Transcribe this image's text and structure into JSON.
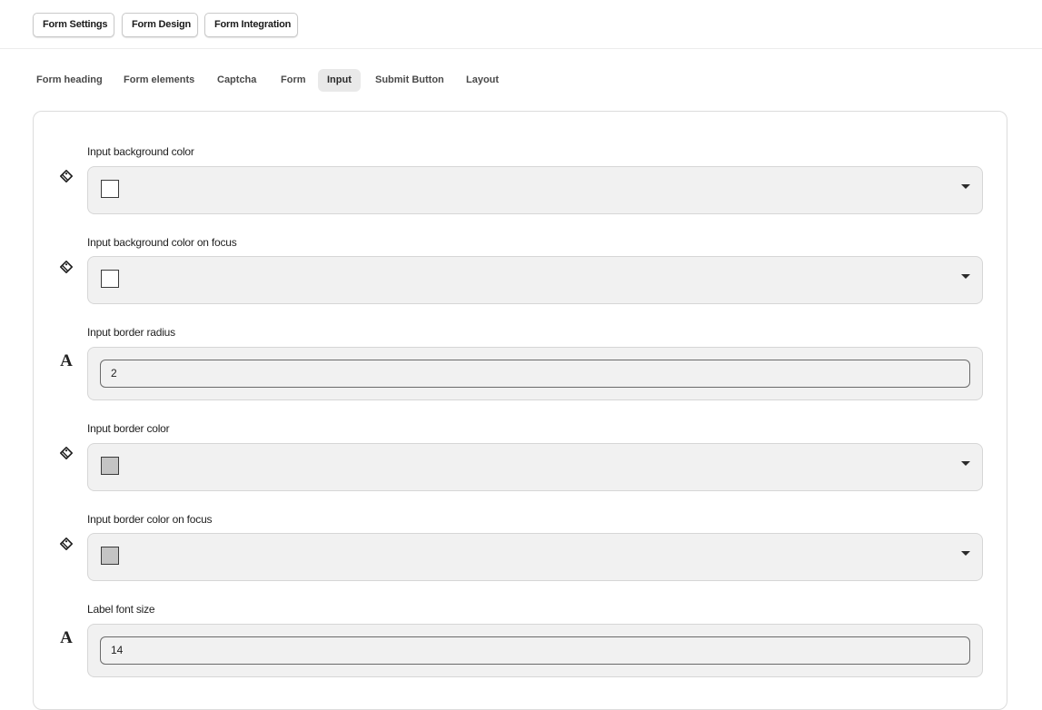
{
  "top_buttons": {
    "form_settings": "Form Settings",
    "form_design": "Form Design",
    "form_integration": "Form Integration"
  },
  "tabs": [
    {
      "label": "Form heading",
      "active": false
    },
    {
      "label": "Form elements",
      "active": false
    },
    {
      "label": "Captcha",
      "active": false
    },
    {
      "label": "Form",
      "active": false
    },
    {
      "label": "Input",
      "active": true
    },
    {
      "label": "Submit Button",
      "active": false
    },
    {
      "label": "Layout",
      "active": false
    }
  ],
  "fields": [
    {
      "label": "Input background color",
      "type": "color",
      "icon": "color-picker-icon",
      "swatch": "#ffffff"
    },
    {
      "label": "Input background color on focus",
      "type": "color",
      "icon": "color-picker-icon",
      "swatch": "#ffffff"
    },
    {
      "label": "Input border radius",
      "type": "number",
      "icon": "text-size-icon",
      "icon_glyph": "A",
      "value": "2"
    },
    {
      "label": "Input border color",
      "type": "color",
      "icon": "color-picker-icon",
      "swatch": "#c4c4c4"
    },
    {
      "label": "Input border color on focus",
      "type": "color",
      "icon": "color-picker-icon",
      "swatch": "#c4c4c4"
    },
    {
      "label": "Label font size",
      "type": "number",
      "icon": "text-size-icon",
      "icon_glyph": "A",
      "value": "14"
    }
  ],
  "colors": {
    "panel_background": "#ffffff",
    "field_background": "#f1f1f1",
    "active_tab_background": "#e9e9e9"
  }
}
